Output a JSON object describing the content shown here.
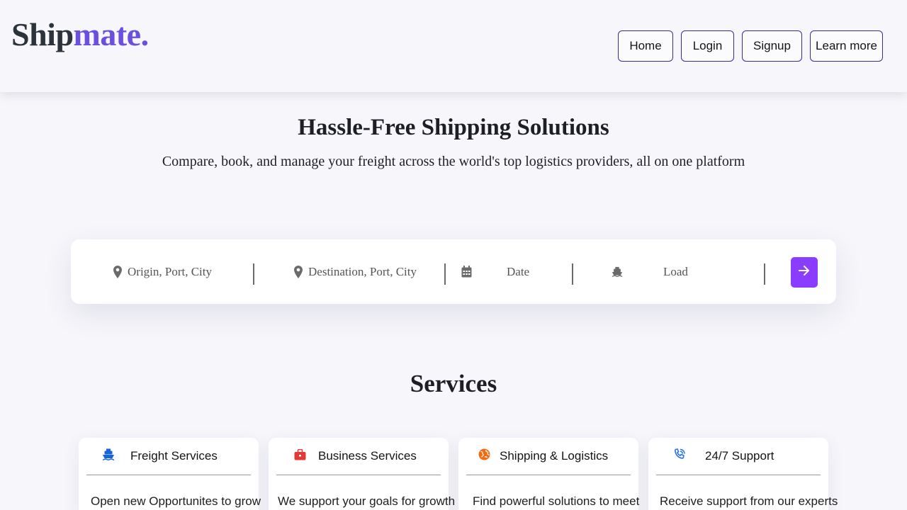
{
  "logo": {
    "part1": "Ship",
    "part2": "mate."
  },
  "nav": [
    {
      "label": "Home"
    },
    {
      "label": "Login"
    },
    {
      "label": "Signup"
    },
    {
      "label": "Learn more"
    }
  ],
  "hero": {
    "title": "Hassle-Free Shipping Solutions",
    "subtitle": "Compare, book, and manage your freight across the world's top logistics providers, all on one platform"
  },
  "search": {
    "origin_placeholder": "Origin, Port, City",
    "destination_placeholder": "Destination, Port, City",
    "date_placeholder": "Date",
    "load_placeholder": "Load",
    "icons": [
      "map-pin-icon",
      "map-pin-icon",
      "calendar-icon",
      "ship-icon",
      "arrow-right-icon"
    ]
  },
  "services": {
    "title": "Services",
    "cards": [
      {
        "title": "Freight Services",
        "text": "Open new Opportunites to grow",
        "icon": "ship-icon",
        "color": "#1565d8"
      },
      {
        "title": "Business Services",
        "text": "We support your goals for growth",
        "icon": "briefcase-icon",
        "color": "#e53935"
      },
      {
        "title": "Shipping & Logistics",
        "text": "Find powerful solutions to meet",
        "icon": "globe-icon",
        "color": "#f26b0f"
      },
      {
        "title": "24/7 Support",
        "text": "Receive support from our experts",
        "icon": "phone-icon",
        "color": "#2a6fe8"
      }
    ]
  },
  "colors": {
    "accent": "#8b3dff",
    "brand": "#6b4fe0",
    "nav_border": "#3b2a9b"
  }
}
